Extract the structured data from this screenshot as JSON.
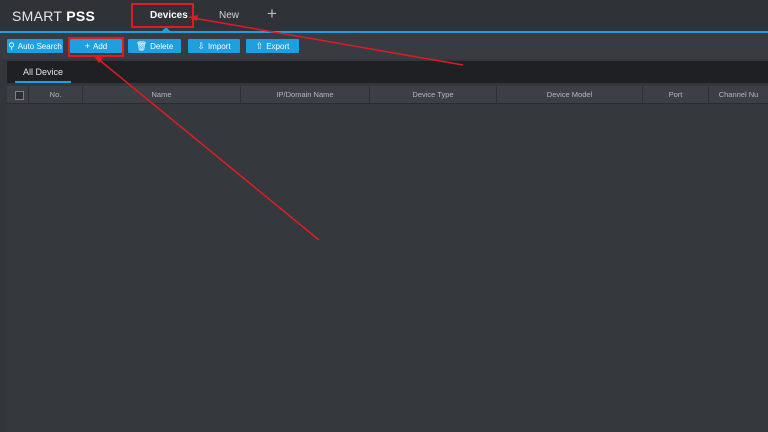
{
  "app": {
    "logo_light": "SMART",
    "logo_bold": "PSS"
  },
  "tabs": {
    "devices": "Devices",
    "new": "New",
    "add_glyph": "+"
  },
  "toolbar": {
    "auto_search": "Auto Search",
    "add": "Add",
    "delete": "Delete",
    "import": "Import",
    "export": "Export"
  },
  "icons": {
    "search": "search-icon",
    "plus": "plus-icon",
    "trash": "trash-icon",
    "import": "import-icon",
    "export": "export-icon",
    "sort": "sort-up-icon"
  },
  "subtabs": [
    "All Device"
  ],
  "table": {
    "columns": [
      "No.",
      "Name",
      "IP/Domain Name",
      "Device Type",
      "Device Model",
      "Port",
      "Channel Nu"
    ],
    "rows": []
  },
  "colors": {
    "accent": "#1e9fe0",
    "annotation": "#e01b24",
    "background": "#33363b"
  }
}
